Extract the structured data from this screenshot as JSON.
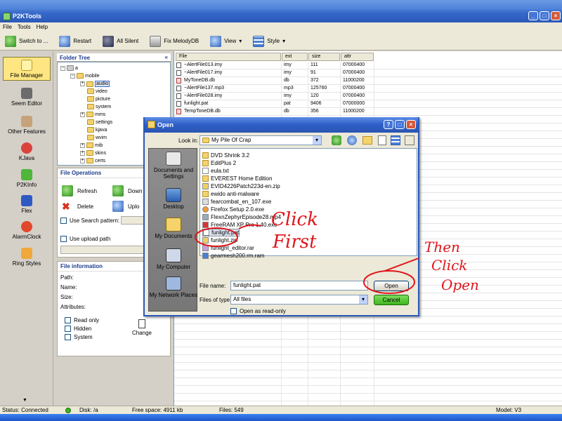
{
  "window": {
    "title": "P2KTools"
  },
  "menu": [
    "File",
    "Tools",
    "Help"
  ],
  "toolbar": {
    "switch": "Switch to ...",
    "restart": "Restart",
    "all_silent": "All Silent",
    "fix_melody": "Fix MelodyDB",
    "view": "View",
    "style": "Style"
  },
  "leftnav": {
    "items": [
      "File Manager",
      "Seem Editor",
      "Other Features",
      "KJava",
      "P2KInfo",
      "Flex",
      "AlarmClock",
      "Ring Styles"
    ]
  },
  "folder_tree": {
    "title": "Folder Tree",
    "root": "a",
    "mobile": "mobile",
    "children": [
      "audio",
      "video",
      "picture",
      "system",
      "mms",
      "settings",
      "kjava",
      "wvim",
      "mib",
      "skins",
      "certs"
    ]
  },
  "file_ops": {
    "title": "File Operations",
    "refresh": "Refresh",
    "download": "Down",
    "delete": "Delete",
    "upload": "Uplo",
    "use_search": "Use Search pattern:",
    "use_upload": "Use upload path"
  },
  "file_info": {
    "title": "File information",
    "path": "Path:",
    "name": "Name:",
    "size": "Size:",
    "attributes": "Attributes:",
    "read_only": "Read only",
    "hidden": "Hidden",
    "system": "System",
    "change": "Change"
  },
  "file_list": {
    "headers": [
      "File",
      "ext",
      "size",
      "attr"
    ],
    "rows": [
      {
        "file": "~AlertFile013.imy",
        "ext": "imy",
        "size": "111",
        "attr": "07000400"
      },
      {
        "file": "~AlertFile017.imy",
        "ext": "imy",
        "size": "91",
        "attr": "07000400"
      },
      {
        "file": "MyToneDB.db",
        "ext": "db",
        "size": "372",
        "attr": "11000200"
      },
      {
        "file": "~AlertFile137.mp3",
        "ext": "mp3",
        "size": "125760",
        "attr": "07000400"
      },
      {
        "file": "~AlertFile028.imy",
        "ext": "imy",
        "size": "120",
        "attr": "07000400"
      },
      {
        "file": "funlight.pat",
        "ext": "pat",
        "size": "9406",
        "attr": "07000000"
      },
      {
        "file": "TempToneDB.db",
        "ext": "db",
        "size": "356",
        "attr": "11000200"
      }
    ]
  },
  "status": {
    "connection": "Status: Connected",
    "disk": "Disk: /a",
    "free_space": "Free space: 4911 kb",
    "files": "Files: 549",
    "model": "Model: V3"
  },
  "dialog": {
    "title": "Open",
    "look_in_label": "Look in:",
    "look_in_value": "My Pile Of Crap",
    "places": [
      "Documents and Settings",
      "Desktop",
      "My Documents",
      "My Computer",
      "My Network Places"
    ],
    "files": [
      "DVD Shrink 3.2",
      "EditPlus 2",
      "eula.txt",
      "EVEREST Home Edition",
      "EVID4226Patch223d-en.zip",
      "ewido anti-malware",
      "fearcombat_en_107.exe",
      "Firefox Setup 2.0.exe",
      "FlexnZephyrEpisode28.mp4",
      "FreeRAM XP Pro 1.40.exe",
      "funlight.pat",
      "funlight.zip",
      "funlight_editor.rar",
      "gearmesh200.rm.ram"
    ],
    "file_name_label": "File name:",
    "file_name_value": "funlight.pat",
    "file_type_label": "Files of type:",
    "file_type_value": "All files",
    "read_only": "Open as read-only",
    "open_btn": "Open",
    "cancel_btn": "Cancel"
  },
  "annotations": {
    "click_first_1": "Click",
    "click_first_2": "First",
    "then_1": "Then",
    "then_2": "Click",
    "then_3": "Open"
  },
  "colors": {
    "annotation": "#e0151b",
    "titlebar": "#2b58b8",
    "cancel_green": "#3fb51f"
  }
}
